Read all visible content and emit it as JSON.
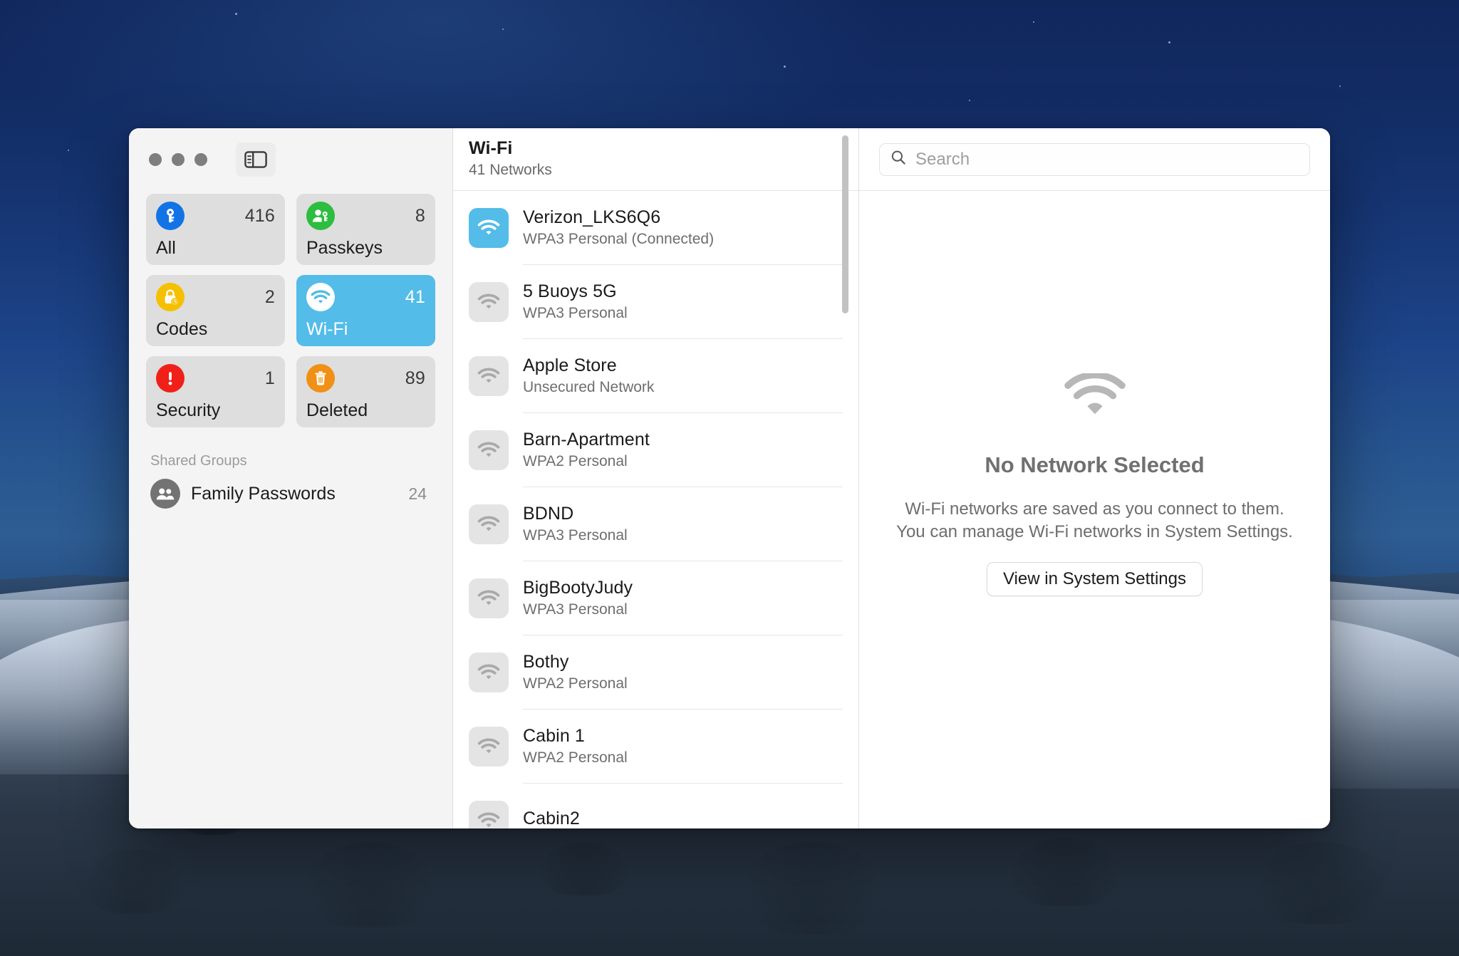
{
  "window": {
    "traffic_lights": [
      "close",
      "minimize",
      "zoom"
    ],
    "sidebar_toggle_icon": "sidebar-toggle-icon"
  },
  "sidebar": {
    "tiles": [
      {
        "id": "all",
        "label": "All",
        "count": "416",
        "icon": "key-icon",
        "icon_color": "#1273e6",
        "selected": false
      },
      {
        "id": "passkeys",
        "label": "Passkeys",
        "count": "8",
        "icon": "passkey-icon",
        "icon_color": "#2dbd3f",
        "selected": false
      },
      {
        "id": "codes",
        "label": "Codes",
        "count": "2",
        "icon": "lock-clock-icon",
        "icon_color": "#f5c000",
        "selected": false
      },
      {
        "id": "wifi",
        "label": "Wi-Fi",
        "count": "41",
        "icon": "wifi-icon",
        "icon_color": "#ffffff",
        "selected": true
      },
      {
        "id": "security",
        "label": "Security",
        "count": "1",
        "icon": "warning-icon",
        "icon_color": "#f02019",
        "selected": false
      },
      {
        "id": "deleted",
        "label": "Deleted",
        "count": "89",
        "icon": "trash-icon",
        "icon_color": "#f09015",
        "selected": false
      }
    ],
    "shared_groups_header": "Shared Groups",
    "shared_groups": [
      {
        "name": "Family Passwords",
        "count": "24",
        "icon": "people-icon"
      }
    ],
    "selected_accent": "#53bce8"
  },
  "list": {
    "title": "Wi-Fi",
    "subtitle": "41 Networks",
    "networks": [
      {
        "name": "Verizon_LKS6Q6",
        "security": "WPA3 Personal (Connected)",
        "connected": true
      },
      {
        "name": "5 Buoys 5G",
        "security": "WPA3 Personal",
        "connected": false
      },
      {
        "name": "Apple Store",
        "security": "Unsecured Network",
        "connected": false
      },
      {
        "name": "Barn-Apartment",
        "security": "WPA2 Personal",
        "connected": false
      },
      {
        "name": "BDND",
        "security": "WPA3 Personal",
        "connected": false
      },
      {
        "name": "BigBootyJudy",
        "security": "WPA3 Personal",
        "connected": false
      },
      {
        "name": "Bothy",
        "security": "WPA2 Personal",
        "connected": false
      },
      {
        "name": "Cabin 1",
        "security": "WPA2 Personal",
        "connected": false
      },
      {
        "name": "Cabin2",
        "security": "",
        "connected": false
      }
    ]
  },
  "detail": {
    "search_placeholder": "Search",
    "search_value": "",
    "empty_icon": "wifi-icon",
    "empty_title": "No Network Selected",
    "empty_desc_line1": "Wi-Fi networks are saved as you connect to them.",
    "empty_desc_line2": "You can manage Wi-Fi networks in System Settings.",
    "empty_button": "View in System Settings"
  }
}
